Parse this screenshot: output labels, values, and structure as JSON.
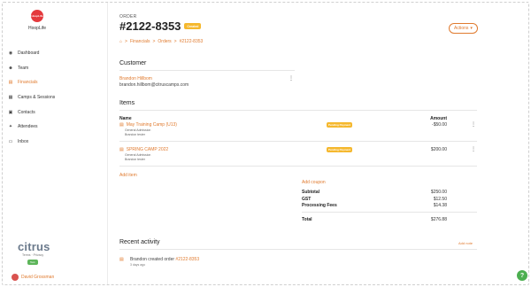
{
  "org": {
    "logo_text": "HoopLife",
    "name": "HoopLife"
  },
  "sidebar": {
    "items": [
      {
        "label": "Dashboard",
        "icon": "dashboard-icon",
        "glyph": "◉"
      },
      {
        "label": "Team",
        "icon": "team-icon",
        "glyph": "☻"
      },
      {
        "label": "Financials",
        "icon": "financials-icon",
        "glyph": "▤",
        "active": true
      },
      {
        "label": "Camps & Sessions",
        "icon": "camps-icon",
        "glyph": "▦"
      },
      {
        "label": "Contacts",
        "icon": "contacts-icon",
        "glyph": "▣"
      },
      {
        "label": "Attendees",
        "icon": "attendees-icon",
        "glyph": "✦"
      },
      {
        "label": "Inbox",
        "icon": "inbox-icon",
        "glyph": "▭"
      }
    ]
  },
  "brand": {
    "name": "citrus",
    "links": "Terms · Privacy",
    "badge": "Test"
  },
  "user": {
    "name": "David Grossman"
  },
  "header": {
    "eyebrow": "ORDER",
    "title": "#2122-8353",
    "status": "Created",
    "actions_label": "Actions"
  },
  "breadcrumb": [
    "Financials",
    "Orders",
    "#2122-8353"
  ],
  "customer": {
    "section_title": "Customer",
    "name": "Brandon Hillbom",
    "email": "brandon.hillbom@citruscamps.com"
  },
  "items": {
    "section_title": "Items",
    "col_name": "Name",
    "col_amount": "Amount",
    "rows": [
      {
        "name": "May Training Camp (U13)",
        "sub1": "General Admission",
        "sub2": "Brandon tester",
        "badge": "Pending Payment",
        "amount": "-$50.00"
      },
      {
        "name": "SPRING CAMP 2022",
        "sub1": "General Admission",
        "sub2": "Brandon tester",
        "badge": "Pending Payment",
        "amount": "$200.00"
      }
    ],
    "add_item": "Add item",
    "add_coupon": "Add coupon"
  },
  "summary": {
    "subtotal_label": "Subtotal",
    "subtotal": "$250.00",
    "gst_label": "GST",
    "gst": "$12.50",
    "fees_label": "Processing Fees",
    "fees": "$14.38",
    "total_label": "Total",
    "total": "$276.88"
  },
  "activity": {
    "section_title": "Recent activity",
    "add_note": "Add note",
    "text": "Brandon created order ",
    "link": "#2122-8353",
    "time": "3 days ago"
  },
  "help": {
    "label": "?"
  }
}
